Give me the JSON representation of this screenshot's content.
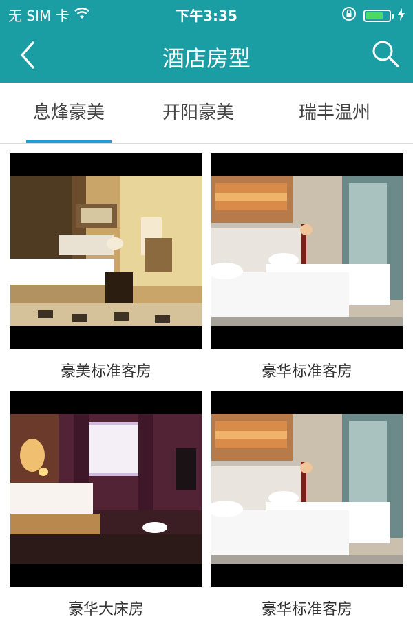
{
  "status_bar": {
    "carrier": "无 SIM 卡",
    "time": "下午3:35",
    "battery_level": 0.75
  },
  "nav": {
    "title": "酒店房型"
  },
  "tabs": [
    {
      "label": "息烽豪美",
      "active": true
    },
    {
      "label": "开阳豪美",
      "active": false
    },
    {
      "label": "瑞丰温州",
      "active": false
    }
  ],
  "rooms": [
    {
      "name": "豪美标准客房"
    },
    {
      "name": "豪华标准客房"
    },
    {
      "name": "豪华大床房"
    },
    {
      "name": "豪华标准客房"
    }
  ],
  "colors": {
    "header": "#1a9da3",
    "tab_indicator": "#1a9fd9"
  }
}
